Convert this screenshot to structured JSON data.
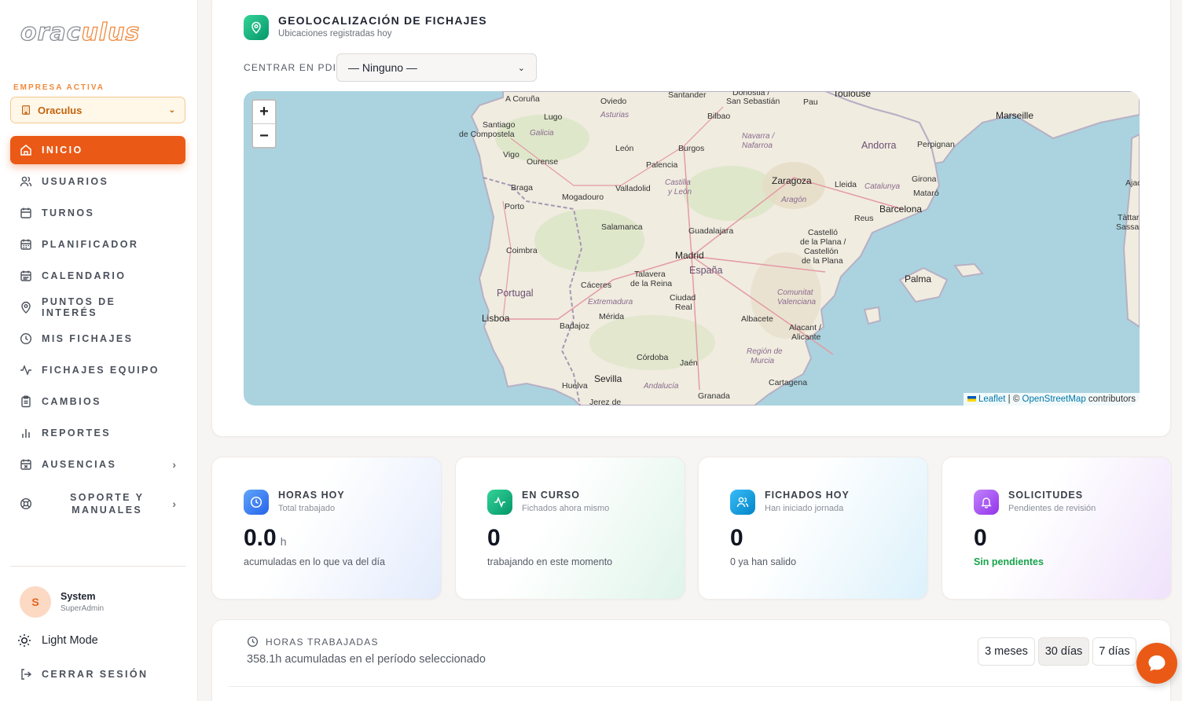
{
  "app": {
    "logo": "oraculus"
  },
  "sidebar": {
    "company_label": "EMPRESA ACTIVA",
    "company_value": "Oraculus",
    "items": [
      {
        "label": "INICIO",
        "icon": "home-icon",
        "active": true
      },
      {
        "label": "USUARIOS",
        "icon": "users-icon"
      },
      {
        "label": "TURNOS",
        "icon": "calendar-icon"
      },
      {
        "label": "PLANIFICADOR",
        "icon": "calendar-grid-icon"
      },
      {
        "label": "CALENDARIO",
        "icon": "calendar-days-icon"
      },
      {
        "label": "PUNTOS DE INTERÉS",
        "icon": "map-pin-icon"
      },
      {
        "label": "MIS FICHAJES",
        "icon": "clock-icon"
      },
      {
        "label": "FICHAJES EQUIPO",
        "icon": "activity-icon"
      },
      {
        "label": "CAMBIOS",
        "icon": "clipboard-icon"
      },
      {
        "label": "REPORTES",
        "icon": "bar-chart-icon"
      },
      {
        "label": "AUSENCIAS",
        "icon": "calendar-x-icon",
        "expandable": true
      },
      {
        "label": "SOPORTE Y MANUALES",
        "icon": "lifebuoy-icon",
        "expandable": true
      }
    ],
    "user": {
      "initial": "S",
      "name": "System",
      "role": "SuperAdmin"
    },
    "theme_toggle": "Light Mode",
    "logout": "CERRAR SESIÓN"
  },
  "geo": {
    "title": "GEOLOCALIZACIÓN DE FICHAJES",
    "subtitle": "Ubicaciones registradas hoy",
    "pdi_label": "CENTRAR EN PDI:",
    "pdi_value": "— Ninguno —",
    "map": {
      "zoom_in": "+",
      "zoom_out": "−",
      "attribution_leaflet": "Leaflet",
      "attribution_sep": " | © ",
      "attribution_osm": "OpenStreetMap",
      "attribution_rest": " contributors",
      "labels": {
        "acoruna": "A Coruña",
        "santiago": "Santiago",
        "decompostela": "de Compostela",
        "lugo": "Lugo",
        "galicia": "Galicia",
        "vigo": "Vigo",
        "ourense": "Ourense",
        "braga": "Braga",
        "porto": "Porto",
        "oviedo": "Oviedo",
        "asturias": "Asturias",
        "santander": "Santander",
        "donostia": "Donostia /",
        "sansebastian": "San Sebastián",
        "bilbao": "Bilbao",
        "pau": "Pau",
        "toulouse": "Toulouse",
        "marseille": "Marseille",
        "leon": "León",
        "burgos": "Burgos",
        "navarra": "Navarra /",
        "nafarroa": "Nafarroa",
        "palencia": "Palencia",
        "valladolid": "Valladolid",
        "castilla": "Castilla",
        "yleon": "y León",
        "zaragoza": "Zaragoza",
        "andorra": "Andorra",
        "perpignan": "Perpignan",
        "lleida": "Lleida",
        "catalunya": "Catalunya",
        "girona": "Girona",
        "mataro": "Mataró",
        "aragon": "Aragón",
        "barcelona": "Barcelona",
        "reus": "Reus",
        "mogadouro": "Mogadouro",
        "salamanca": "Salamanca",
        "guadalajara": "Guadalajara",
        "madrid": "Madrid",
        "espana": "España",
        "castello": "Castelló",
        "delaplana1": "de la Plana /",
        "castellon": "Castellón",
        "delaplana2": "de la Plana",
        "coimbra": "Coimbra",
        "talavera": "Talavera",
        "delareina": "de la Reina",
        "caceres": "Cáceres",
        "portugal": "Portugal",
        "ciudad": "Ciudad",
        "real": "Real",
        "extremadura": "Extremadura",
        "merida": "Mérida",
        "comunitat": "Comunitat",
        "valenciana": "Valenciana",
        "lisboa": "Lisboa",
        "badajoz": "Badajoz",
        "albacete": "Albacete",
        "alacant": "Alacant /",
        "alicante": "Alicante",
        "palma": "Palma",
        "cordoba": "Córdoba",
        "jaen": "Jaén",
        "regionde": "Región de",
        "murcia": "Murcia",
        "cartagena": "Cartagena",
        "sevilla": "Sevilla",
        "huelva": "Huelva",
        "andalucia": "Andalucía",
        "granada": "Granada",
        "jerez": "Jerez de",
        "ajac": "Ajac",
        "tattari": "Tàttari",
        "sassari": "Sassar"
      }
    }
  },
  "stats": [
    {
      "title": "HORAS HOY",
      "subtitle": "Total trabajado",
      "value": "0.0",
      "unit": "h",
      "desc": "acumuladas en lo que va del día",
      "icon": "clock-icon",
      "color": "#3b82f6"
    },
    {
      "title": "EN CURSO",
      "subtitle": "Fichados ahora mismo",
      "value": "0",
      "desc": "trabajando en este momento",
      "icon": "activity-icon",
      "color": "#10b981"
    },
    {
      "title": "FICHADOS HOY",
      "subtitle": "Han iniciado jornada",
      "value": "0",
      "desc": "0 ya han salido",
      "icon": "users-icon",
      "color": "#0ea5e9"
    },
    {
      "title": "SOLICITUDES",
      "subtitle": "Pendientes de revisión",
      "value": "0",
      "desc": "Sin pendientes",
      "icon": "bell-icon",
      "color": "#a855f7"
    }
  ],
  "hours": {
    "title": "HORAS TRABAJADAS",
    "subtitle": "358.1h acumuladas en el período seleccionado",
    "ranges": [
      "3 meses",
      "30 días",
      "7 días"
    ],
    "selected": "30 días"
  }
}
